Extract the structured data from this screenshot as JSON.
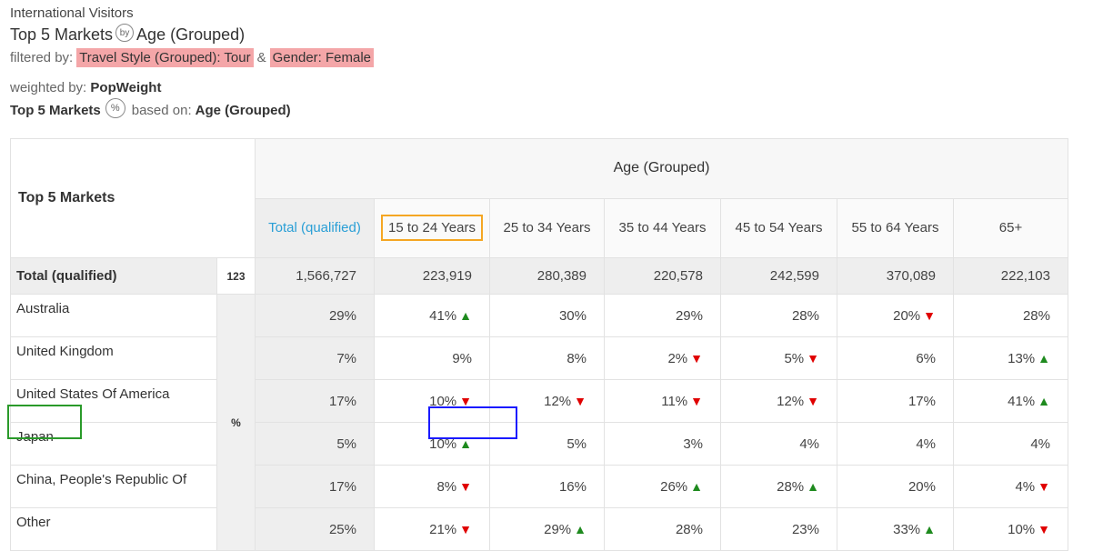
{
  "header": {
    "subtitle": "International Visitors",
    "title_left": "Top 5 Markets",
    "by_icon_text": "by",
    "title_right": "Age (Grouped)",
    "filter_prefix": "filtered by:",
    "filters": [
      "Travel Style (Grouped): Tour",
      "Gender: Female"
    ],
    "filter_joiner": "&",
    "weight_prefix": "weighted by:",
    "weight_value": "PopWeight",
    "base_left": "Top 5 Markets",
    "pct_icon_text": "%",
    "based_on_prefix": "based on:",
    "based_on_value": "Age (Grouped)"
  },
  "table": {
    "row_header": "Top 5 Markets",
    "group_header": "Age (Grouped)",
    "columns": [
      "Total (qualified)",
      "15 to 24 Years",
      "25 to 34 Years",
      "35 to 44 Years",
      "45 to 54 Years",
      "55 to 64 Years",
      "65+"
    ],
    "total_row": {
      "label": "Total (qualified)",
      "unit": "123",
      "values": [
        "1,566,727",
        "223,919",
        "280,389",
        "220,578",
        "242,599",
        "370,089",
        "222,103"
      ]
    },
    "unit_label": "%",
    "rows": [
      {
        "label": "Australia",
        "cells": [
          {
            "v": "29%",
            "a": ""
          },
          {
            "v": "41%",
            "a": "up"
          },
          {
            "v": "30%",
            "a": ""
          },
          {
            "v": "29%",
            "a": ""
          },
          {
            "v": "28%",
            "a": ""
          },
          {
            "v": "20%",
            "a": "down"
          },
          {
            "v": "28%",
            "a": ""
          }
        ]
      },
      {
        "label": "United Kingdom",
        "cells": [
          {
            "v": "7%",
            "a": ""
          },
          {
            "v": "9%",
            "a": ""
          },
          {
            "v": "8%",
            "a": ""
          },
          {
            "v": "2%",
            "a": "down"
          },
          {
            "v": "5%",
            "a": "down"
          },
          {
            "v": "6%",
            "a": ""
          },
          {
            "v": "13%",
            "a": "up"
          }
        ]
      },
      {
        "label": "United States Of America",
        "cells": [
          {
            "v": "17%",
            "a": ""
          },
          {
            "v": "10%",
            "a": "down"
          },
          {
            "v": "12%",
            "a": "down"
          },
          {
            "v": "11%",
            "a": "down"
          },
          {
            "v": "12%",
            "a": "down"
          },
          {
            "v": "17%",
            "a": ""
          },
          {
            "v": "41%",
            "a": "up"
          }
        ]
      },
      {
        "label": "Japan",
        "cells": [
          {
            "v": "5%",
            "a": ""
          },
          {
            "v": "10%",
            "a": "up"
          },
          {
            "v": "5%",
            "a": ""
          },
          {
            "v": "3%",
            "a": ""
          },
          {
            "v": "4%",
            "a": ""
          },
          {
            "v": "4%",
            "a": ""
          },
          {
            "v": "4%",
            "a": ""
          }
        ]
      },
      {
        "label": "China, People's Republic Of",
        "cells": [
          {
            "v": "17%",
            "a": ""
          },
          {
            "v": "8%",
            "a": "down"
          },
          {
            "v": "16%",
            "a": ""
          },
          {
            "v": "26%",
            "a": "up"
          },
          {
            "v": "28%",
            "a": "up"
          },
          {
            "v": "20%",
            "a": ""
          },
          {
            "v": "4%",
            "a": "down"
          }
        ]
      },
      {
        "label": "Other",
        "cells": [
          {
            "v": "25%",
            "a": ""
          },
          {
            "v": "21%",
            "a": "down"
          },
          {
            "v": "29%",
            "a": "up"
          },
          {
            "v": "28%",
            "a": ""
          },
          {
            "v": "23%",
            "a": ""
          },
          {
            "v": "33%",
            "a": "up"
          },
          {
            "v": "10%",
            "a": "down"
          }
        ]
      }
    ]
  },
  "colors": {
    "filter_chip": "#f4a6a8",
    "total_column_text": "#2a9fd6",
    "up_arrow": "#1e8a1e",
    "down_arrow": "#e00000",
    "highlight_orange": "#f5a623",
    "highlight_blue": "#1a1aff",
    "highlight_green": "#2a9a2a"
  },
  "icons": {
    "up": "triangle-up-icon",
    "down": "triangle-down-icon"
  }
}
